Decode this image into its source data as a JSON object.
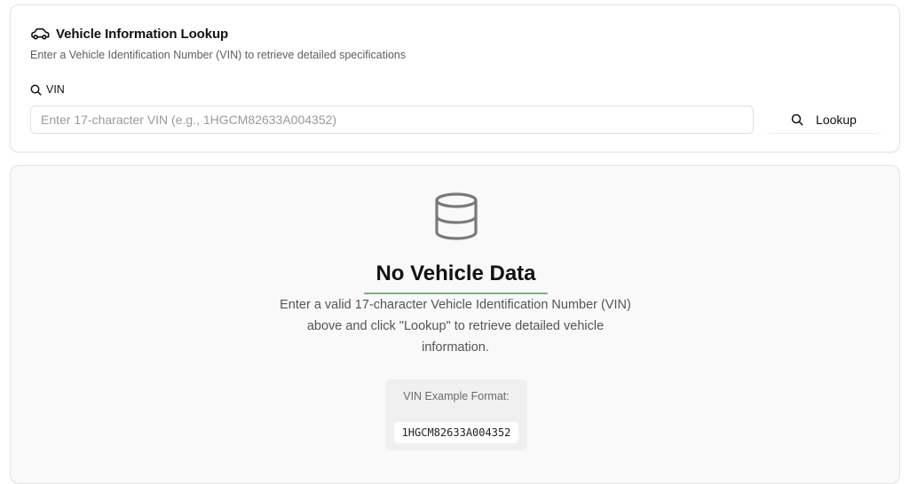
{
  "header": {
    "title": "Vehicle Information Lookup",
    "subtitle": "Enter a Vehicle Identification Number (VIN) to retrieve detailed specifications",
    "icon": "car-icon"
  },
  "form": {
    "vin_label": "VIN",
    "vin_label_icon": "search-icon",
    "vin_placeholder": "Enter 17-character VIN (e.g., 1HGCM82633A004352)",
    "vin_value": "",
    "lookup_button_label": "Lookup",
    "lookup_button_icon": "search-icon"
  },
  "empty_state": {
    "icon": "database-icon",
    "title": "No Vehicle Data",
    "description": "Enter a valid 17-character Vehicle Identification Number (VIN) above and click \"Lookup\" to retrieve detailed vehicle information.",
    "example_label": "VIN Example Format:",
    "example_code": "1HGCM82633A004352"
  },
  "colors": {
    "accent_underline": "#4caf50",
    "panel_background": "#f9f9f9",
    "border": "#e4e4e4"
  }
}
